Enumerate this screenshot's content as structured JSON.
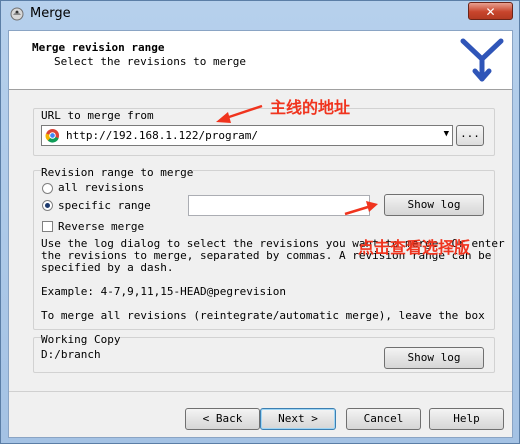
{
  "window": {
    "title": "Merge",
    "close_glyph": "✕"
  },
  "header": {
    "title": "Merge revision range",
    "subtitle": "Select the revisions to merge",
    "logo_icon": "merge-arrows-icon"
  },
  "url_group": {
    "label": "URL to merge from",
    "url": "http://192.168.1.122/program/",
    "browse_label": "..."
  },
  "range_group": {
    "label": "Revision range to merge",
    "option_all": "all revisions",
    "option_specific": "specific range",
    "selected": "specific range",
    "range_value": "",
    "show_log": "Show log",
    "reverse_merge": "Reverse merge",
    "reverse_checked": false,
    "help_lines": [
      "Use the log dialog to select the revisions you want to merge. Or enter",
      "the revisions to merge, separated by commas. A revision range can be",
      "specified by a dash."
    ],
    "example": "Example: 4-7,9,11,15-HEAD@pegrevision",
    "reintegrate_note": "To merge all revisions (reintegrate/automatic merge), leave the box"
  },
  "working_copy": {
    "label": "Working Copy",
    "path": "D:/branch",
    "show_log": "Show log"
  },
  "buttons": {
    "back": "< Back",
    "next": "Next >",
    "cancel": "Cancel",
    "help": "Help"
  },
  "annotations": {
    "url_note": "主线的地址",
    "log_note": "点击查看选择版"
  },
  "colors": {
    "annotation": "#f0341e",
    "titlebar": "#b6d0ec",
    "close": "#c8452c"
  }
}
